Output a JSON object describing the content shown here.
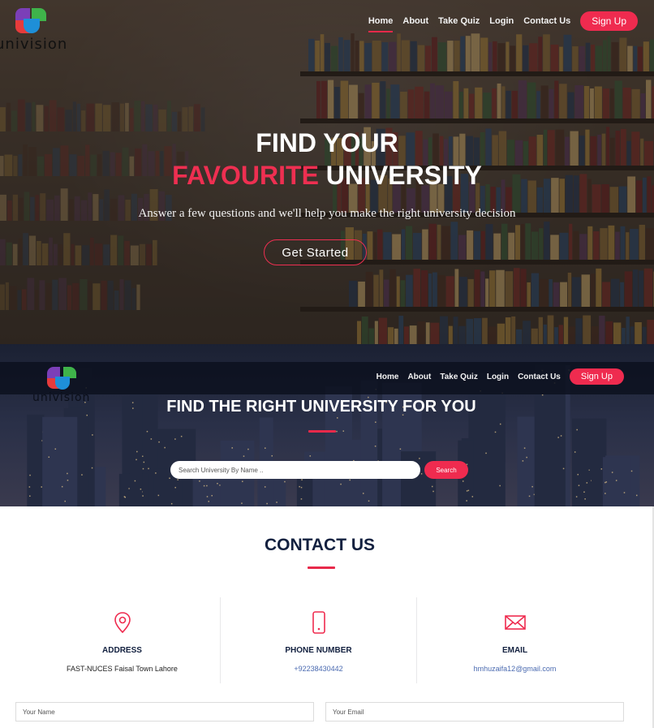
{
  "brand": {
    "logo_text": "univision"
  },
  "hero": {
    "nav": [
      "Home",
      "About",
      "Take Quiz",
      "Login",
      "Contact Us"
    ],
    "signup_label": "Sign Up",
    "title_line1": "FIND YOUR",
    "title_line2_accent": "FAVOURITE",
    "title_line2_rest": " UNIVERSITY",
    "subtitle": "Answer a few questions and we'll help you make the right university decision",
    "cta_label": "Get Started"
  },
  "search_section": {
    "nav": [
      "Home",
      "About",
      "Take Quiz",
      "Login",
      "Contact Us"
    ],
    "signup_label": "Sign Up",
    "title": "FIND THE RIGHT UNIVERSITY FOR YOU",
    "search_placeholder": "Search University By Name ..",
    "search_button": "Search"
  },
  "contact": {
    "title": "CONTACT US",
    "columns": [
      {
        "icon": "map-pin-icon",
        "label": "ADDRESS",
        "value": "FAST-NUCES Faisal Town Lahore"
      },
      {
        "icon": "phone-icon",
        "label": "PHONE NUMBER",
        "value": "+92238430442"
      },
      {
        "icon": "envelope-icon",
        "label": "EMAIL",
        "value": "hmhuzaifa12@gmail.com"
      }
    ],
    "name_placeholder": "Your Name",
    "email_placeholder": "Your Email"
  },
  "colors": {
    "accent": "#ef2b4f",
    "heading": "#12203f",
    "link": "#4a6ab0"
  }
}
